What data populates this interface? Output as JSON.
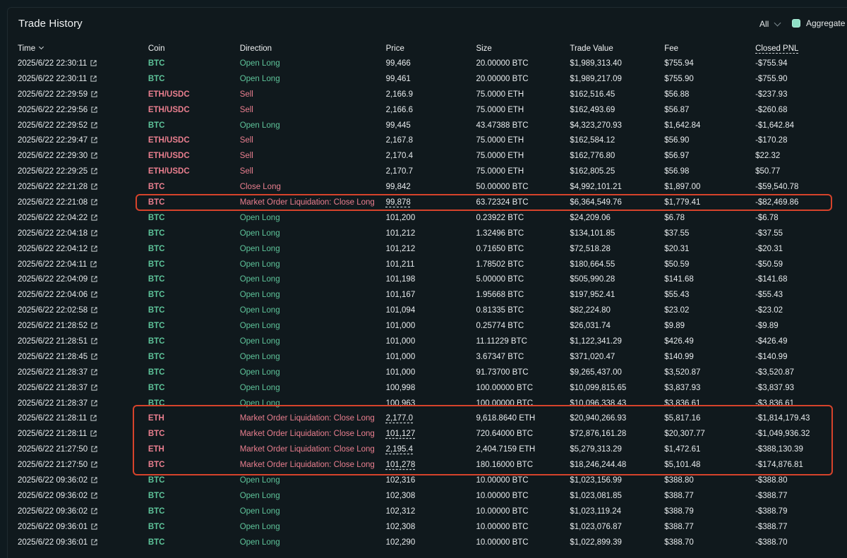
{
  "header": {
    "title": "Trade History",
    "filter_value": "All",
    "aggregate_label": "Aggregate",
    "aggregate_checked": true
  },
  "columns": [
    "Time",
    "Coin",
    "Direction",
    "Price",
    "Size",
    "Trade Value",
    "Fee",
    "Closed PNL"
  ],
  "colors": {
    "long": "#5ec49a",
    "short": "#ea7f8f",
    "highlight": "#d6432b",
    "checkbox": "#8fe0c6"
  },
  "rows": [
    {
      "time": "2025/6/22 22:30:11",
      "coin": "BTC",
      "coin_side": "long",
      "direction": "Open Long",
      "price": "99,466",
      "size": "20.00000 BTC",
      "value": "$1,989,313.40",
      "fee": "$755.94",
      "pnl": "-$755.94"
    },
    {
      "time": "2025/6/22 22:30:11",
      "coin": "BTC",
      "coin_side": "long",
      "direction": "Open Long",
      "price": "99,461",
      "size": "20.00000 BTC",
      "value": "$1,989,217.09",
      "fee": "$755.90",
      "pnl": "-$755.90"
    },
    {
      "time": "2025/6/22 22:29:59",
      "coin": "ETH/USDC",
      "coin_side": "short",
      "direction": "Sell",
      "price": "2,166.9",
      "size": "75.0000 ETH",
      "value": "$162,516.45",
      "fee": "$56.88",
      "pnl": "-$237.93"
    },
    {
      "time": "2025/6/22 22:29:56",
      "coin": "ETH/USDC",
      "coin_side": "short",
      "direction": "Sell",
      "price": "2,166.6",
      "size": "75.0000 ETH",
      "value": "$162,493.69",
      "fee": "$56.87",
      "pnl": "-$260.68"
    },
    {
      "time": "2025/6/22 22:29:52",
      "coin": "BTC",
      "coin_side": "long",
      "direction": "Open Long",
      "price": "99,445",
      "size": "43.47388 BTC",
      "value": "$4,323,270.93",
      "fee": "$1,642.84",
      "pnl": "-$1,642.84"
    },
    {
      "time": "2025/6/22 22:29:47",
      "coin": "ETH/USDC",
      "coin_side": "short",
      "direction": "Sell",
      "price": "2,167.8",
      "size": "75.0000 ETH",
      "value": "$162,584.12",
      "fee": "$56.90",
      "pnl": "-$170.28"
    },
    {
      "time": "2025/6/22 22:29:30",
      "coin": "ETH/USDC",
      "coin_side": "short",
      "direction": "Sell",
      "price": "2,170.4",
      "size": "75.0000 ETH",
      "value": "$162,776.80",
      "fee": "$56.97",
      "pnl": "$22.32"
    },
    {
      "time": "2025/6/22 22:29:25",
      "coin": "ETH/USDC",
      "coin_side": "short",
      "direction": "Sell",
      "price": "2,170.7",
      "size": "75.0000 ETH",
      "value": "$162,805.25",
      "fee": "$56.98",
      "pnl": "$50.77"
    },
    {
      "time": "2025/6/22 22:21:28",
      "coin": "BTC",
      "coin_side": "short",
      "direction": "Close Long",
      "price": "99,842",
      "size": "50.00000 BTC",
      "value": "$4,992,101.21",
      "fee": "$1,897.00",
      "pnl": "-$59,540.78"
    },
    {
      "time": "2025/6/22 22:21:08",
      "coin": "BTC",
      "coin_side": "short",
      "direction": "Market Order Liquidation: Close Long",
      "price": "99,878",
      "size": "63.72324 BTC",
      "value": "$6,364,549.76",
      "fee": "$1,779.41",
      "pnl": "-$82,469.86",
      "liquidation": true
    },
    {
      "time": "2025/6/22 22:04:22",
      "coin": "BTC",
      "coin_side": "long",
      "direction": "Open Long",
      "price": "101,200",
      "size": "0.23922 BTC",
      "value": "$24,209.06",
      "fee": "$6.78",
      "pnl": "-$6.78"
    },
    {
      "time": "2025/6/22 22:04:18",
      "coin": "BTC",
      "coin_side": "long",
      "direction": "Open Long",
      "price": "101,212",
      "size": "1.32496 BTC",
      "value": "$134,101.85",
      "fee": "$37.55",
      "pnl": "-$37.55"
    },
    {
      "time": "2025/6/22 22:04:12",
      "coin": "BTC",
      "coin_side": "long",
      "direction": "Open Long",
      "price": "101,212",
      "size": "0.71650 BTC",
      "value": "$72,518.28",
      "fee": "$20.31",
      "pnl": "-$20.31"
    },
    {
      "time": "2025/6/22 22:04:11",
      "coin": "BTC",
      "coin_side": "long",
      "direction": "Open Long",
      "price": "101,211",
      "size": "1.78502 BTC",
      "value": "$180,664.55",
      "fee": "$50.59",
      "pnl": "-$50.59"
    },
    {
      "time": "2025/6/22 22:04:09",
      "coin": "BTC",
      "coin_side": "long",
      "direction": "Open Long",
      "price": "101,198",
      "size": "5.00000 BTC",
      "value": "$505,990.28",
      "fee": "$141.68",
      "pnl": "-$141.68"
    },
    {
      "time": "2025/6/22 22:04:06",
      "coin": "BTC",
      "coin_side": "long",
      "direction": "Open Long",
      "price": "101,167",
      "size": "1.95668 BTC",
      "value": "$197,952.41",
      "fee": "$55.43",
      "pnl": "-$55.43"
    },
    {
      "time": "2025/6/22 22:02:58",
      "coin": "BTC",
      "coin_side": "long",
      "direction": "Open Long",
      "price": "101,094",
      "size": "0.81335 BTC",
      "value": "$82,224.80",
      "fee": "$23.02",
      "pnl": "-$23.02"
    },
    {
      "time": "2025/6/22 21:28:52",
      "coin": "BTC",
      "coin_side": "long",
      "direction": "Open Long",
      "price": "101,000",
      "size": "0.25774 BTC",
      "value": "$26,031.74",
      "fee": "$9.89",
      "pnl": "-$9.89"
    },
    {
      "time": "2025/6/22 21:28:51",
      "coin": "BTC",
      "coin_side": "long",
      "direction": "Open Long",
      "price": "101,000",
      "size": "11.11229 BTC",
      "value": "$1,122,341.29",
      "fee": "$426.49",
      "pnl": "-$426.49"
    },
    {
      "time": "2025/6/22 21:28:45",
      "coin": "BTC",
      "coin_side": "long",
      "direction": "Open Long",
      "price": "101,000",
      "size": "3.67347 BTC",
      "value": "$371,020.47",
      "fee": "$140.99",
      "pnl": "-$140.99"
    },
    {
      "time": "2025/6/22 21:28:37",
      "coin": "BTC",
      "coin_side": "long",
      "direction": "Open Long",
      "price": "101,000",
      "size": "91.73700 BTC",
      "value": "$9,265,437.00",
      "fee": "$3,520.87",
      "pnl": "-$3,520.87"
    },
    {
      "time": "2025/6/22 21:28:37",
      "coin": "BTC",
      "coin_side": "long",
      "direction": "Open Long",
      "price": "100,998",
      "size": "100.00000 BTC",
      "value": "$10,099,815.65",
      "fee": "$3,837.93",
      "pnl": "-$3,837.93"
    },
    {
      "time": "2025/6/22 21:28:37",
      "coin": "BTC",
      "coin_side": "long",
      "direction": "Open Long",
      "price": "100,963",
      "size": "100.00000 BTC",
      "value": "$10,096,338.43",
      "fee": "$3,836.61",
      "pnl": "-$3,836.61"
    },
    {
      "time": "2025/6/22 21:28:11",
      "coin": "ETH",
      "coin_side": "short",
      "direction": "Market Order Liquidation: Close Long",
      "price": "2,177.0",
      "size": "9,618.8640 ETH",
      "value": "$20,940,266.93",
      "fee": "$5,817.16",
      "pnl": "-$1,814,179.43",
      "liquidation": true
    },
    {
      "time": "2025/6/22 21:28:11",
      "coin": "BTC",
      "coin_side": "short",
      "direction": "Market Order Liquidation: Close Long",
      "price": "101,127",
      "size": "720.64000 BTC",
      "value": "$72,876,161.28",
      "fee": "$20,307.77",
      "pnl": "-$1,049,936.32",
      "liquidation": true
    },
    {
      "time": "2025/6/22 21:27:50",
      "coin": "ETH",
      "coin_side": "short",
      "direction": "Market Order Liquidation: Close Long",
      "price": "2,195.4",
      "size": "2,404.7159 ETH",
      "value": "$5,279,313.29",
      "fee": "$1,472.61",
      "pnl": "-$388,130.39",
      "liquidation": true
    },
    {
      "time": "2025/6/22 21:27:50",
      "coin": "BTC",
      "coin_side": "short",
      "direction": "Market Order Liquidation: Close Long",
      "price": "101,278",
      "size": "180.16000 BTC",
      "value": "$18,246,244.48",
      "fee": "$5,101.48",
      "pnl": "-$174,876.81",
      "liquidation": true
    },
    {
      "time": "2025/6/22 09:36:02",
      "coin": "BTC",
      "coin_side": "long",
      "direction": "Open Long",
      "price": "102,316",
      "size": "10.00000 BTC",
      "value": "$1,023,156.99",
      "fee": "$388.80",
      "pnl": "-$388.80"
    },
    {
      "time": "2025/6/22 09:36:02",
      "coin": "BTC",
      "coin_side": "long",
      "direction": "Open Long",
      "price": "102,308",
      "size": "10.00000 BTC",
      "value": "$1,023,081.85",
      "fee": "$388.77",
      "pnl": "-$388.77"
    },
    {
      "time": "2025/6/22 09:36:02",
      "coin": "BTC",
      "coin_side": "long",
      "direction": "Open Long",
      "price": "102,312",
      "size": "10.00000 BTC",
      "value": "$1,023,119.24",
      "fee": "$388.79",
      "pnl": "-$388.79"
    },
    {
      "time": "2025/6/22 09:36:01",
      "coin": "BTC",
      "coin_side": "long",
      "direction": "Open Long",
      "price": "102,308",
      "size": "10.00000 BTC",
      "value": "$1,023,076.87",
      "fee": "$388.77",
      "pnl": "-$388.77"
    },
    {
      "time": "2025/6/22 09:36:01",
      "coin": "BTC",
      "coin_side": "long",
      "direction": "Open Long",
      "price": "102,290",
      "size": "10.00000 BTC",
      "value": "$1,022,899.39",
      "fee": "$388.70",
      "pnl": "-$388.70"
    }
  ]
}
